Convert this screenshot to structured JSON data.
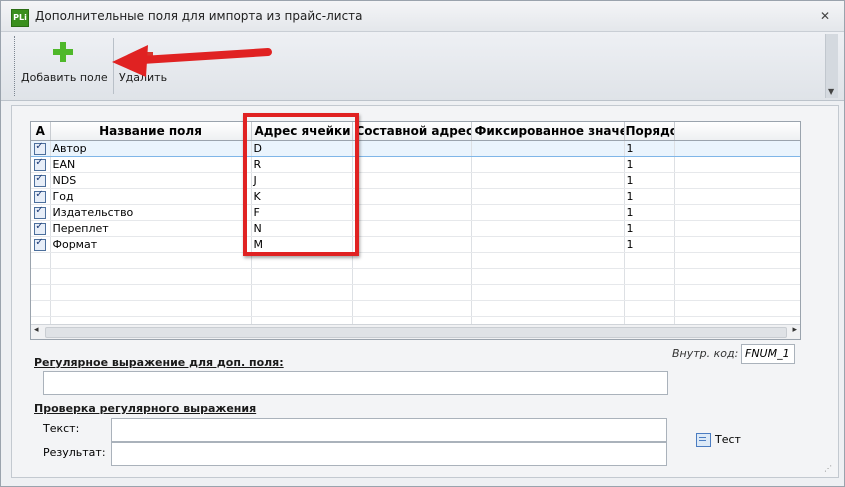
{
  "window": {
    "title": "Дополнительные поля для импорта из прайс-листа",
    "app_icon_text": "PLi",
    "close_glyph": "✕"
  },
  "toolbar": {
    "add_label": "Добавить поле",
    "delete_label": "Удалить",
    "scroll_glyph": "▼"
  },
  "grid": {
    "columns": [
      "A",
      "Название поля",
      "Адрес ячейки",
      "Составной адрес",
      "Фиксированное значение",
      "Порядок"
    ],
    "rows": [
      {
        "checked": true,
        "name": "Автор",
        "address": "D",
        "composite": "",
        "fixed": "",
        "order": "1"
      },
      {
        "checked": true,
        "name": "EAN",
        "address": "R",
        "composite": "",
        "fixed": "",
        "order": "1"
      },
      {
        "checked": true,
        "name": "NDS",
        "address": "J",
        "composite": "",
        "fixed": "",
        "order": "1"
      },
      {
        "checked": true,
        "name": "Год",
        "address": "K",
        "composite": "",
        "fixed": "",
        "order": "1"
      },
      {
        "checked": true,
        "name": "Издательство",
        "address": "F",
        "composite": "",
        "fixed": "",
        "order": "1"
      },
      {
        "checked": true,
        "name": "Переплет",
        "address": "N",
        "composite": "",
        "fixed": "",
        "order": "1"
      },
      {
        "checked": true,
        "name": "Формат",
        "address": "M",
        "composite": "",
        "fixed": "",
        "order": "1"
      }
    ],
    "selected_row": 0,
    "empty_rows": 5,
    "scroll_left": "◂",
    "scroll_right": "▸"
  },
  "regex": {
    "section_label": "Регулярное выражение для доп. поля:",
    "value": ""
  },
  "code": {
    "label": "Внутр. код:",
    "value": "FNUM_1"
  },
  "check": {
    "section_label": "Проверка регулярного выражения",
    "text_label": "Текст:",
    "text_value": "",
    "result_label": "Результат:",
    "result_value": "",
    "test_button": "Тест"
  },
  "colors": {
    "highlight": "#e02222",
    "add_icon": "#4fb82a",
    "delete_icon": "#d8362d"
  }
}
